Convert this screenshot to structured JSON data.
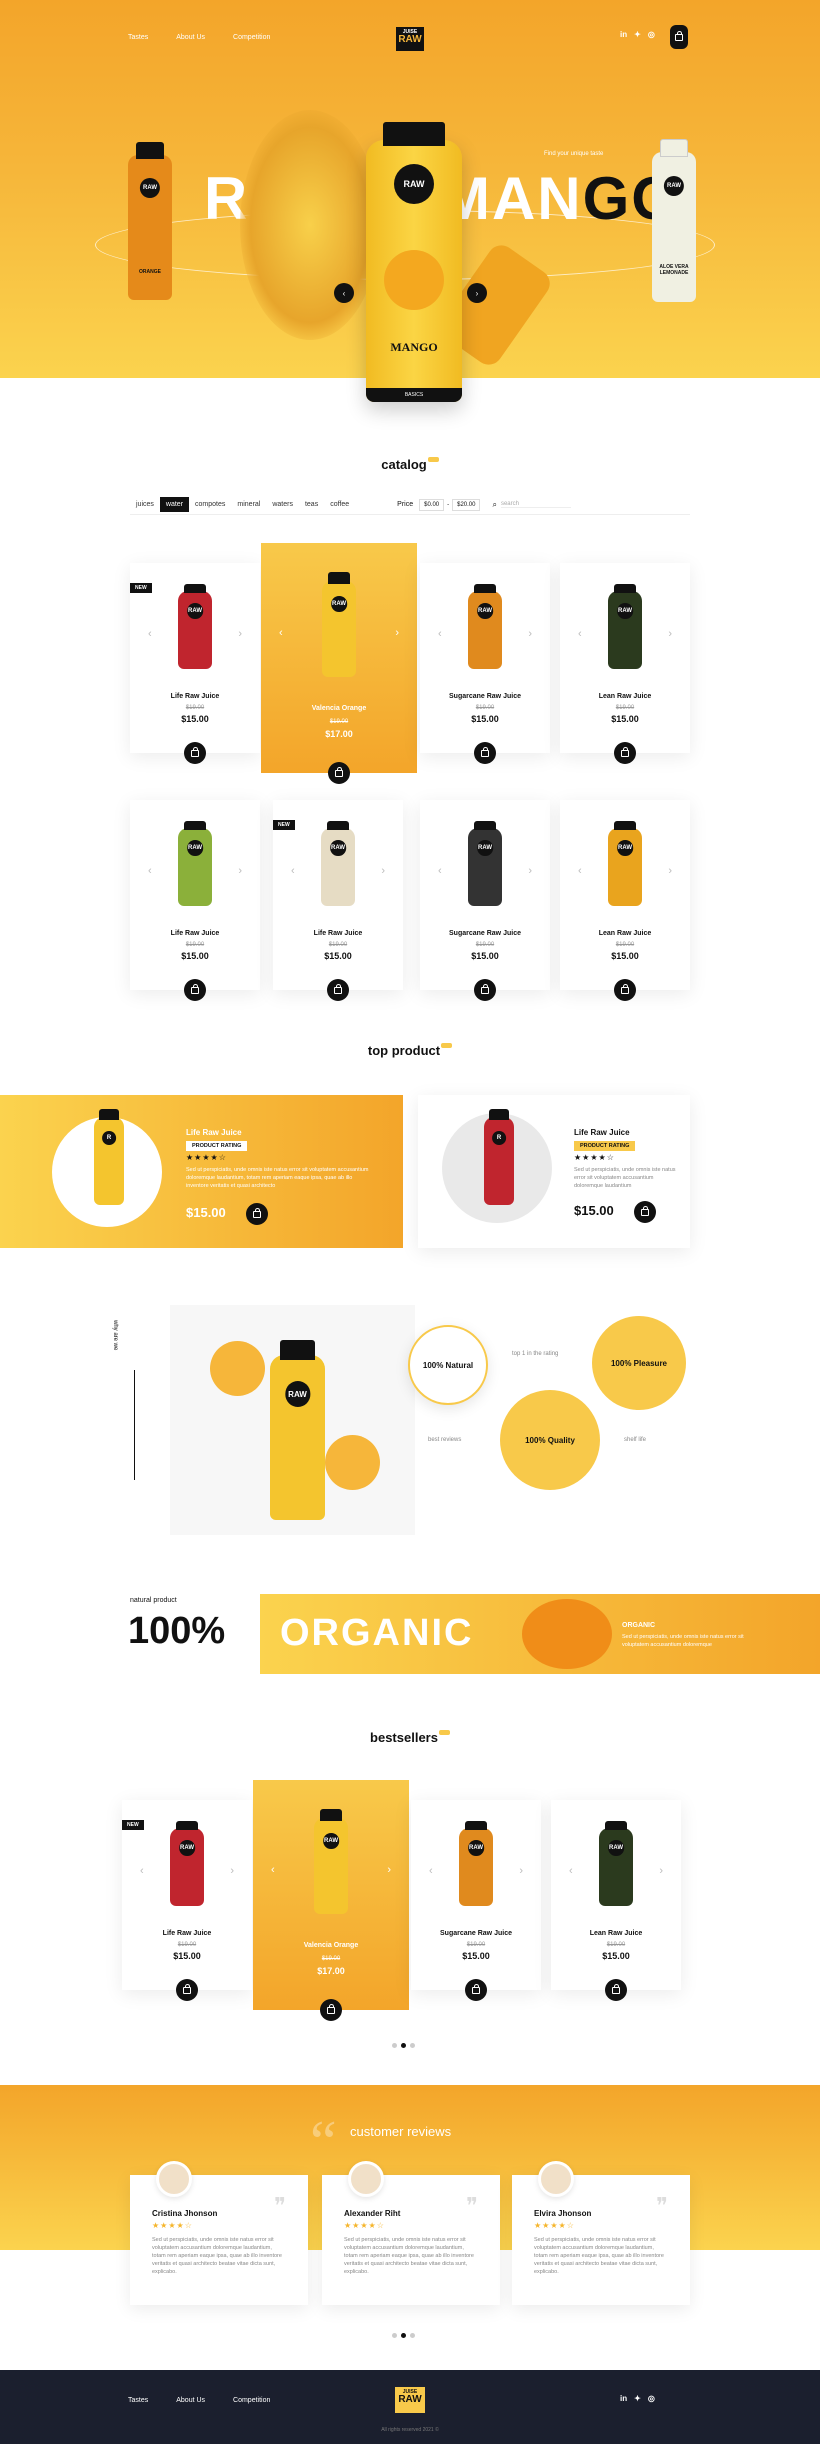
{
  "nav": {
    "links": [
      "Tastes",
      "About Us",
      "Competition"
    ],
    "logo_top": "JUISE",
    "logo_bottom": "RAW",
    "social": [
      "in",
      "t",
      "o"
    ]
  },
  "hero": {
    "title_left": "RAW",
    "title_mid": "MAN",
    "title_right": "GO",
    "tagline": "Find your unique taste",
    "bottle_label": "MANGO",
    "bottle_sub": "BASICS",
    "left_label": "ORANGE",
    "right_label": "ALOE VERA LEMONADE"
  },
  "catalog": {
    "title": "catalog",
    "tabs": [
      "juices",
      "water",
      "compotes",
      "mineral",
      "waters",
      "teas",
      "coffee"
    ],
    "active_tab": "water",
    "price_label": "Price",
    "price_min": "$0.00",
    "price_max": "$20.00",
    "search_placeholder": "search"
  },
  "products_row1": [
    {
      "name": "Life Raw Juice",
      "old": "$19.00",
      "price": "$15.00",
      "badge": "NEW",
      "color": "#c0252e"
    },
    {
      "name": "Valencia Orange",
      "old": "$19.00",
      "price": "$17.00",
      "badge": "",
      "color": "#f4c52e"
    },
    {
      "name": "Sugarcane Raw Juice",
      "old": "$19.00",
      "price": "$15.00",
      "badge": "",
      "color": "#e08a1e"
    },
    {
      "name": "Lean Raw Juice",
      "old": "$19.00",
      "price": "$15.00",
      "badge": "",
      "color": "#2b3a1e"
    }
  ],
  "products_row2": [
    {
      "name": "Life Raw Juice",
      "old": "$19.00",
      "price": "$15.00",
      "badge": "",
      "color": "#8bb03a"
    },
    {
      "name": "Life Raw Juice",
      "old": "$19.00",
      "price": "$15.00",
      "badge": "NEW",
      "color": "#e6dcc4"
    },
    {
      "name": "Sugarcane Raw Juice",
      "old": "$19.00",
      "price": "$15.00",
      "badge": "",
      "color": "#333333"
    },
    {
      "name": "Lean Raw Juice",
      "old": "$19.00",
      "price": "$15.00",
      "badge": "",
      "color": "#e9a41e"
    }
  ],
  "top_product": {
    "title": "top product",
    "left": {
      "name": "Life Raw Juice",
      "rating_label": "PRODUCT RATING",
      "desc": "Sed ut perspiciatis, unde omnis iste natus error sit voluptatem accusantium doloremque laudantium, totam rem aperiam eaque ipsa, quae ab illo inventore veritatis et quasi architecto",
      "price": "$15.00"
    },
    "right": {
      "name": "Life Raw Juice",
      "rating_label": "PRODUCT RATING",
      "desc": "Sed ut perspiciatis, unde omnis iste natus error sit voluptatem accusantium doloremque laudantium",
      "price": "$15.00"
    }
  },
  "why": {
    "side": "why are we",
    "items": [
      "100% Natural",
      "100% Pleasure",
      "100% Quality"
    ],
    "labels": [
      "top 1 in the rating",
      "best reviews",
      "shelf life"
    ]
  },
  "organic": {
    "small": "natural product",
    "big": "100%",
    "word": "ORGANIC",
    "label": "ORGANIC",
    "desc": "Sed ut perspiciatis, unde omnis iste natus error sit voluptatem accusantium doloremque"
  },
  "bestsellers": {
    "title": "bestsellers",
    "items": [
      {
        "name": "Life Raw Juice",
        "old": "$19.00",
        "price": "$15.00",
        "badge": "NEW",
        "color": "#c0252e"
      },
      {
        "name": "Valencia Orange",
        "old": "$19.00",
        "price": "$17.00",
        "badge": "",
        "color": "#f4c52e"
      },
      {
        "name": "Sugarcane Raw Juice",
        "old": "$19.00",
        "price": "$15.00",
        "badge": "",
        "color": "#e08a1e"
      },
      {
        "name": "Lean Raw Juice",
        "old": "$19.00",
        "price": "$15.00",
        "badge": "",
        "color": "#2b3a1e"
      }
    ]
  },
  "reviews": {
    "title": "customer reviews",
    "items": [
      {
        "name": "Cristina Jhonson",
        "text": "Sed ut perspiciatis, unde omnis iste natus error sit voluptatem accusantium doloremque laudantium, totam rem aperiam eaque ipsa, quae ab illo inventore veritatis et quasi architecto beatae vitae dicta sunt, explicabo."
      },
      {
        "name": "Alexander Riht",
        "text": "Sed ut perspiciatis, unde omnis iste natus error sit voluptatem accusantium doloremque laudantium, totam rem aperiam eaque ipsa, quae ab illo inventore veritatis et quasi architecto beatae vitae dicta sunt, explicabo."
      },
      {
        "name": "Elvira Jhonson",
        "text": "Sed ut perspiciatis, unde omnis iste natus error sit voluptatem accusantium doloremque laudantium, totam rem aperiam eaque ipsa, quae ab illo inventore veritatis et quasi architecto beatae vitae dicta sunt, explicabo."
      }
    ]
  },
  "footer": {
    "links": [
      "Tastes",
      "About Us",
      "Competition"
    ],
    "copyright": "All rights reserved 2021 ©"
  }
}
